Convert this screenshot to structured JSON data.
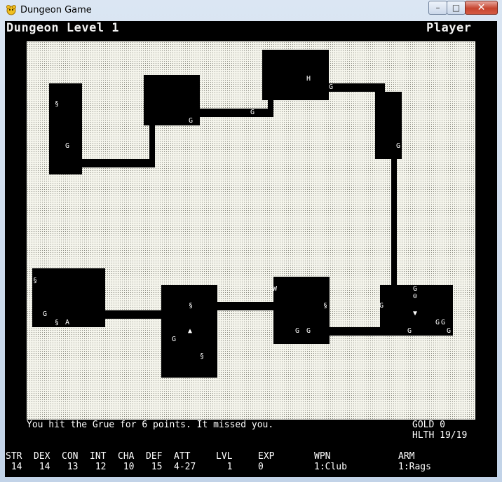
{
  "window": {
    "title": "Dungeon Game",
    "min_glyph": "–",
    "max_glyph": "□",
    "close_glyph": "✕"
  },
  "header": {
    "level": "Dungeon Level 1",
    "player": "Player"
  },
  "message": "You hit the Grue for 6 points. It missed you.",
  "status": {
    "gold": "GOLD 0",
    "health": "HLTH 19/19"
  },
  "stats": [
    {
      "key": "str",
      "label": "STR",
      "value": " 14"
    },
    {
      "key": "dex",
      "label": "DEX",
      "value": " 14"
    },
    {
      "key": "con",
      "label": "CON",
      "value": " 13"
    },
    {
      "key": "int",
      "label": "INT",
      "value": " 12"
    },
    {
      "key": "cha",
      "label": "CHA",
      "value": " 10"
    },
    {
      "key": "def",
      "label": "DEF",
      "value": " 15"
    },
    {
      "key": "att",
      "label": "ATT",
      "value": "4-27"
    },
    {
      "key": "lvl",
      "label": "LVL",
      "value": "  1"
    },
    {
      "key": "exp",
      "label": "EXP",
      "value": "0"
    },
    {
      "key": "wpn",
      "label": "WPN",
      "value": "1:Club"
    },
    {
      "key": "arm",
      "label": "ARM",
      "value": "1:Rags"
    }
  ],
  "map_symbols": {
    "grue": "G",
    "treasure": "§",
    "player": "▲",
    "stairs_down": "▼",
    "hero": "H",
    "weapon": "W",
    "armor": "A",
    "smiley": "☺"
  },
  "colors": {
    "floor": "#f5f5ec",
    "wall": "#000000",
    "text": "#ffffff"
  }
}
